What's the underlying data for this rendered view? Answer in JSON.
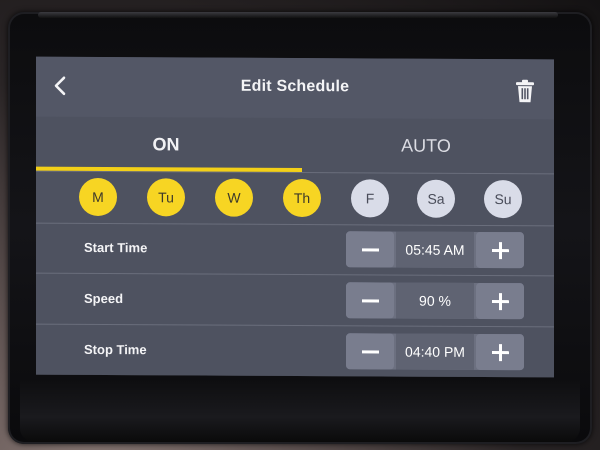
{
  "header": {
    "title": "Edit Schedule",
    "back_icon": "chevron-left-icon",
    "delete_icon": "trash-icon"
  },
  "tabs": [
    {
      "label": "ON",
      "active": true
    },
    {
      "label": "AUTO",
      "active": false
    }
  ],
  "days": [
    {
      "label": "M",
      "selected": true
    },
    {
      "label": "Tu",
      "selected": true
    },
    {
      "label": "W",
      "selected": true
    },
    {
      "label": "Th",
      "selected": true
    },
    {
      "label": "F",
      "selected": false
    },
    {
      "label": "Sa",
      "selected": false
    },
    {
      "label": "Su",
      "selected": false
    }
  ],
  "settings": [
    {
      "label": "Start Time",
      "value": "05:45 AM"
    },
    {
      "label": "Speed",
      "value": "90 %"
    },
    {
      "label": "Stop Time",
      "value": "04:40 PM"
    }
  ],
  "colors": {
    "accent": "#f3d018",
    "selected_day": "#f7d523",
    "unselected_day": "#d9dce8",
    "screen_bg": "#4e5260"
  }
}
